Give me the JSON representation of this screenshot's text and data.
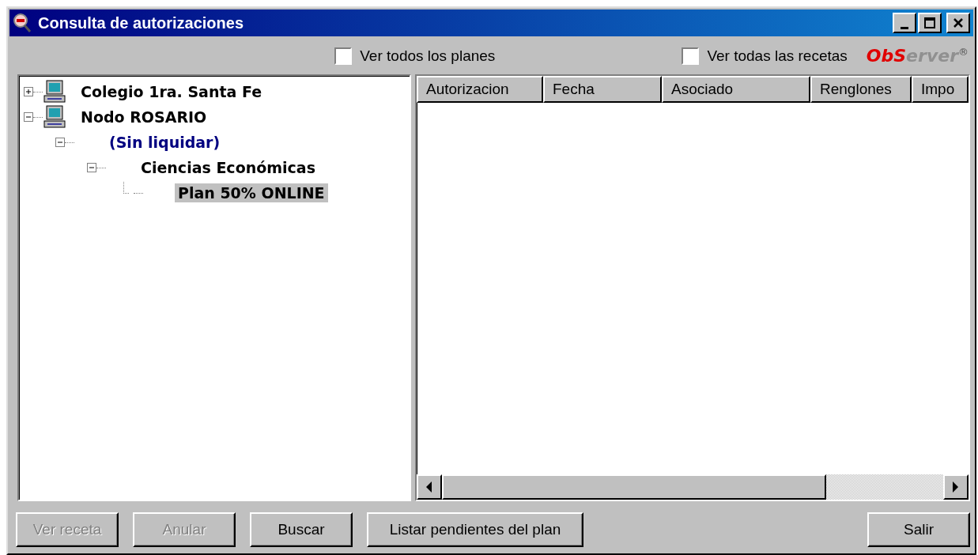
{
  "window": {
    "title": "Consulta de autorizaciones"
  },
  "options": [
    {
      "label": "Ver todos los planes",
      "checked": false
    },
    {
      "label": "Ver todas las recetas",
      "checked": false
    }
  ],
  "logo": {
    "red_part": "ObS",
    "grey_part": "erver",
    "mark": "®"
  },
  "tree": [
    {
      "label": "Colegio 1ra. Santa Fe",
      "kind": "computer",
      "expanded": false,
      "selected": false,
      "color": "#000000"
    },
    {
      "label": "Nodo ROSARIO",
      "kind": "computer",
      "expanded": true,
      "selected": false,
      "color": "#000000",
      "children": [
        {
          "label": "(Sin liquidar)",
          "expanded": true,
          "selected": false,
          "color": "#000080",
          "children": [
            {
              "label": "Ciencias Económicas",
              "expanded": true,
              "selected": false,
              "color": "#000000",
              "children": [
                {
                  "label": "Plan 50% ONLINE",
                  "selected": true,
                  "color": "#000000"
                }
              ]
            }
          ]
        }
      ]
    }
  ],
  "table": {
    "columns": [
      "Autorizacion",
      "Fecha",
      "Asociado",
      "Renglones",
      "Impo"
    ]
  },
  "buttons": [
    {
      "label": "Ver receta",
      "disabled": true
    },
    {
      "label": "Anular",
      "disabled": true
    },
    {
      "label": "Buscar",
      "disabled": false
    },
    {
      "label": "Listar pendientes del plan",
      "disabled": false
    }
  ],
  "exit_button": {
    "label": "Salir",
    "disabled": false
  }
}
